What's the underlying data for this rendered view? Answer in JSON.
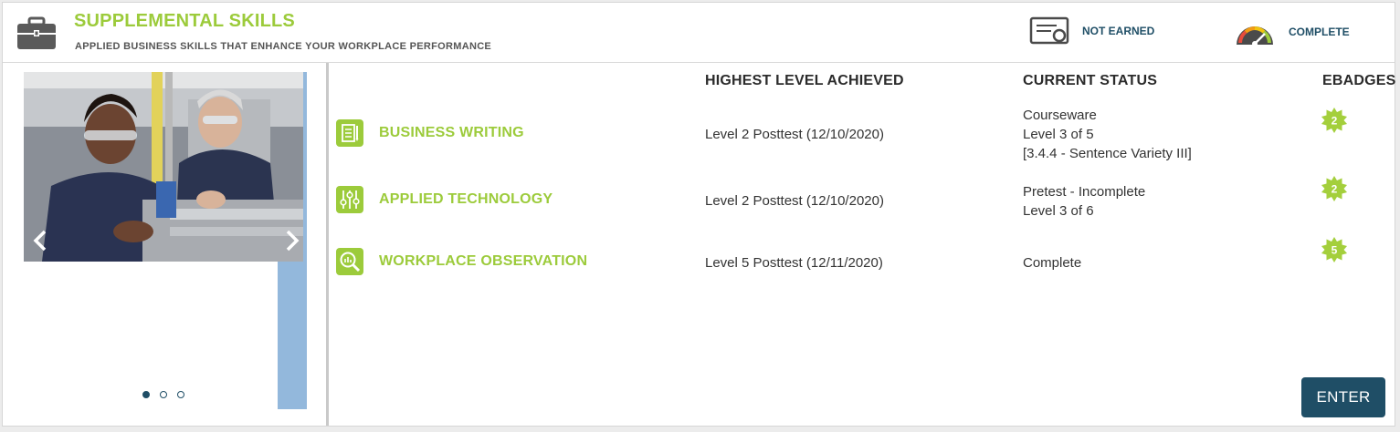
{
  "header": {
    "title": "SUPPLEMENTAL SKILLS",
    "subtitle": "APPLIED BUSINESS SKILLS THAT ENHANCE YOUR WORKPLACE PERFORMANCE",
    "icon": "briefcase-icon",
    "legend": [
      {
        "icon": "certificate-icon",
        "label": "NOT EARNED"
      },
      {
        "icon": "gauge-icon",
        "label": "COMPLETE"
      }
    ]
  },
  "carousel": {
    "slide_count": 3,
    "active_slide": 1
  },
  "table": {
    "headers": {
      "highest_level": "HIGHEST LEVEL ACHIEVED",
      "current_status": "CURRENT STATUS",
      "ebadges": "EBADGES"
    },
    "rows": [
      {
        "icon": "document-icon",
        "name": "BUSINESS WRITING",
        "highest_level": "Level 2 Posttest (12/10/2020)",
        "status_line1": "Courseware",
        "status_line2": "Level 3 of 5",
        "status_line3": "[3.4.4 - Sentence Variety III]",
        "badge": "2"
      },
      {
        "icon": "sliders-icon",
        "name": "APPLIED TECHNOLOGY",
        "highest_level": "Level 2 Posttest (12/10/2020)",
        "status_line1": "Pretest - Incomplete",
        "status_line2": "Level 3 of 6",
        "badge": "2"
      },
      {
        "icon": "magnifier-chart-icon",
        "name": "WORKPLACE OBSERVATION",
        "highest_level": "Level 5 Posttest (12/11/2020)",
        "status_line1": "Complete",
        "badge": "5"
      }
    ]
  },
  "enter_button": "ENTER",
  "colors": {
    "brand_green": "#9ccb3b",
    "navy": "#1f4e66",
    "badge_green": "#a4cf3c",
    "carousel_strip": "#93b8dc"
  }
}
